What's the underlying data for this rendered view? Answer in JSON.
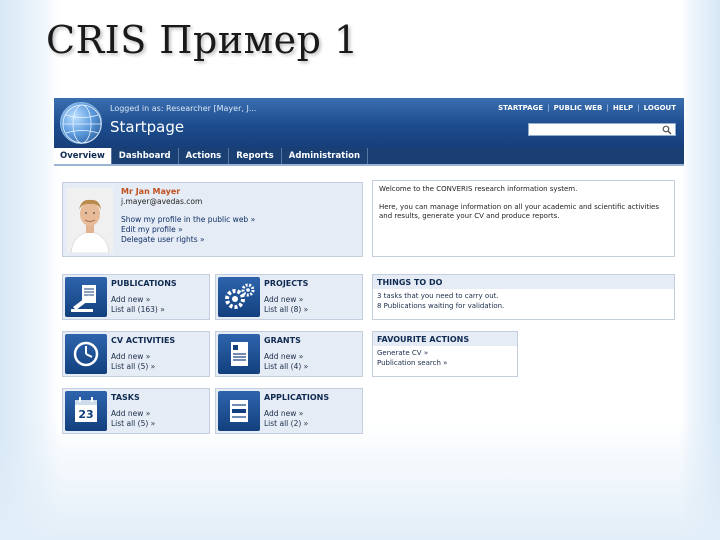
{
  "slide": {
    "title": "CRIS Пример 1"
  },
  "header": {
    "logged_in": "Logged in as: Researcher [Mayer, J...",
    "page_title": "Startpage",
    "links": [
      "STARTPAGE",
      "PUBLIC WEB",
      "HELP",
      "LOGOUT"
    ],
    "search_placeholder": ""
  },
  "nav": {
    "tabs": [
      "Overview",
      "Dashboard",
      "Actions",
      "Reports",
      "Administration"
    ],
    "active": "Overview"
  },
  "profile": {
    "name": "Mr Jan Mayer",
    "email": "j.mayer@avedas.com",
    "links": [
      "Show my profile in the public web »",
      "Edit my profile »",
      "Delegate user rights »"
    ]
  },
  "welcome": {
    "line1": "Welcome to the CONVERIS research information system.",
    "line2": "Here, you can manage information on all your academic and scientific activities and results, generate your CV and produce reports."
  },
  "modules": {
    "publications": {
      "title": "PUBLICATIONS",
      "links": [
        "Add new »",
        "List all (163) »"
      ]
    },
    "projects": {
      "title": "PROJECTS",
      "links": [
        "Add new »",
        "List all (8) »"
      ]
    },
    "cv": {
      "title": "CV ACTIVITIES",
      "links": [
        "Add new »",
        "List all (5) »"
      ]
    },
    "grants": {
      "title": "GRANTS",
      "links": [
        "Add new »",
        "List all (4) »"
      ]
    },
    "tasks": {
      "title": "TASKS",
      "links": [
        "Add new »",
        "List all (5) »"
      ],
      "calendar_day": "23"
    },
    "applications": {
      "title": "APPLICATIONS",
      "links": [
        "Add new »",
        "List all (2) »"
      ]
    }
  },
  "todo": {
    "title": "THINGS TO DO",
    "items": [
      "3 tasks that you need to carry out.",
      "8 Publications waiting for validation."
    ]
  },
  "favourites": {
    "title": "FAVOURITE ACTIONS",
    "items": [
      "Generate CV »",
      "Publication search »"
    ]
  },
  "colors": {
    "header_blue": "#1d4c8e",
    "nav_blue": "#1a3f73",
    "accent_orange": "#c0501e",
    "panel_bg": "#e6ecf5"
  }
}
